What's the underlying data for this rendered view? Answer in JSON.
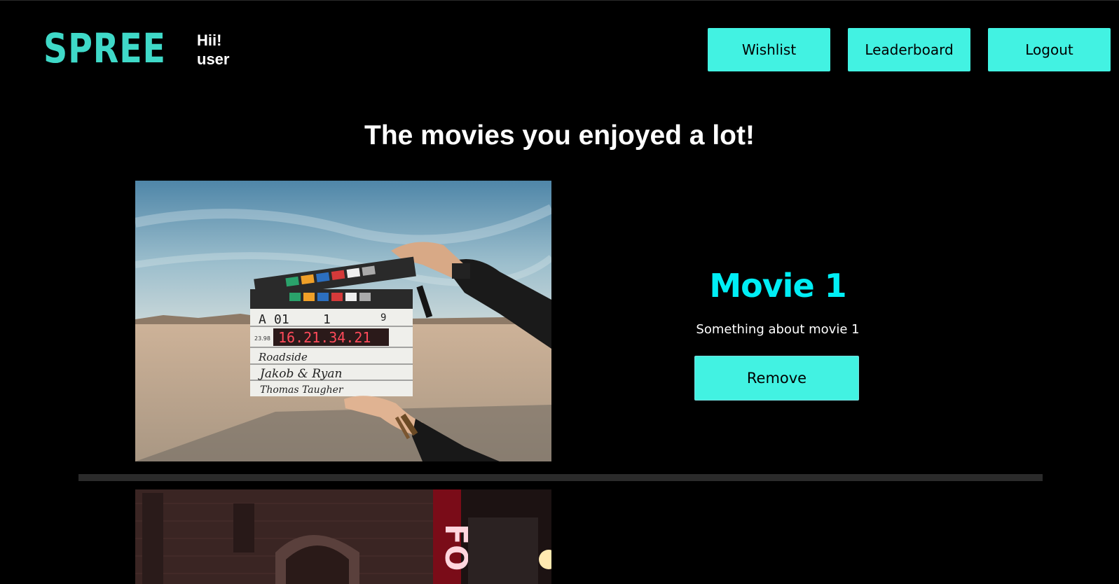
{
  "header": {
    "logo": "SPREE",
    "greeting_line1": "Hii!",
    "greeting_line2": "user",
    "nav": {
      "wishlist": "Wishlist",
      "leaderboard": "Leaderboard",
      "logout": "Logout"
    }
  },
  "main": {
    "title": "The movies you enjoyed a lot!",
    "movies": [
      {
        "title": "Movie 1",
        "description": "Something about movie 1",
        "remove_label": "Remove",
        "clapper": {
          "roll": "A",
          "scene": "01",
          "take": "1",
          "num": "9",
          "fps": "23.98",
          "timecode": "16.21.34.21",
          "production": "Roadside",
          "director": "Jakob & Ryan",
          "camera": "Thomas Taugher"
        }
      },
      {
        "sign_text": "FO"
      }
    ]
  },
  "colors": {
    "accent": "#42f2e2",
    "movie_title": "#00eef5",
    "logo": "#3fd9c8",
    "background": "#000000"
  }
}
